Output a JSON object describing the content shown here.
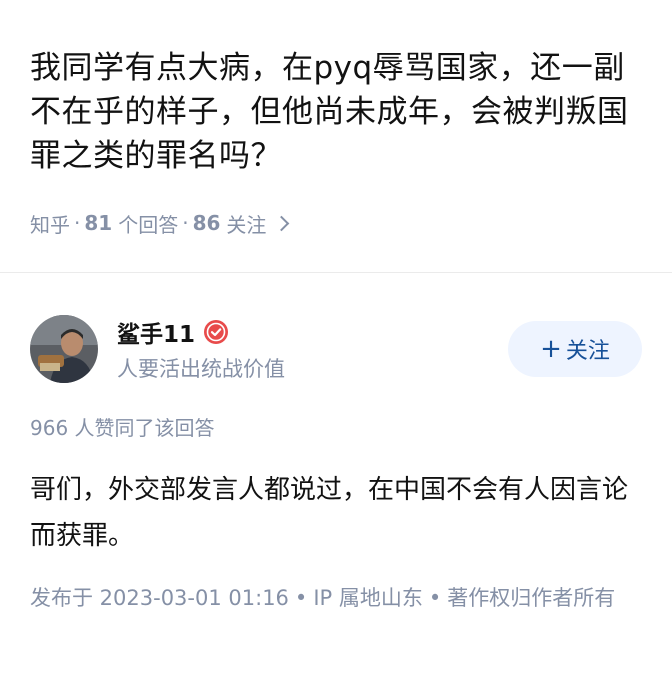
{
  "question": {
    "title": "我同学有点大病，在pyq辱骂国家，还一副不在乎的样子，但他尚未成年，会被判叛国罪之类的罪名吗？",
    "site": "知乎",
    "answer_count": "81",
    "answer_label": "个回答",
    "follower_count": "86",
    "follower_label": "关注"
  },
  "author": {
    "name": "鲨手11",
    "bio": "人要活出统战价值",
    "follow_label": "关注",
    "avatar_icon": "avatar-photo",
    "verify_icon": "verified-badge-icon"
  },
  "answer": {
    "vote_text": "966 人赞同了该回答",
    "content": "哥们，外交部发言人都说过，在中国不会有人因言论而获罪。",
    "publish_time": "发布于 2023-03-01 01:16",
    "ip_location": "IP 属地山东",
    "copyright": "著作权归作者所有"
  },
  "colors": {
    "meta_gray": "#8590a6",
    "follow_bg": "#eef4ff",
    "follow_text": "#175199",
    "badge_red": "#e84b4b"
  }
}
